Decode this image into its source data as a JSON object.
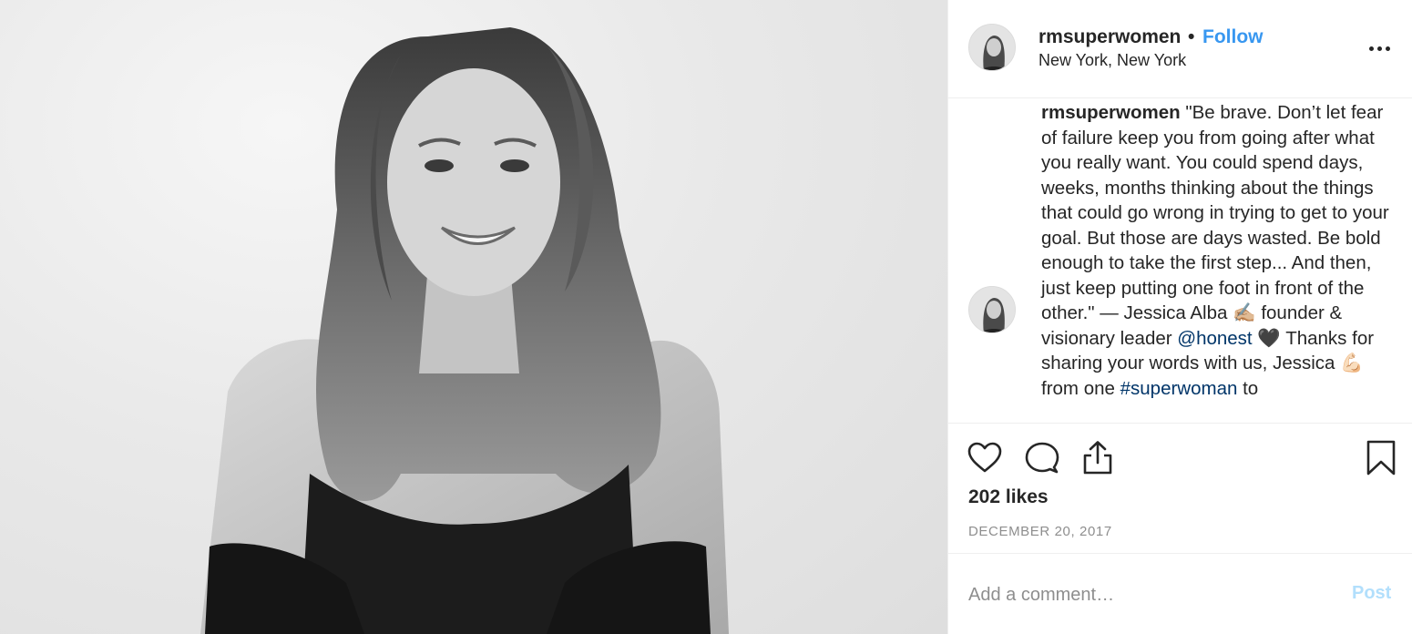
{
  "post": {
    "image_alt": "Black and white portrait photo",
    "header": {
      "username": "rmsuperwomen",
      "separator": "•",
      "follow_label": "Follow",
      "location": "New York, New York",
      "more_icon": "more-horizontal-icon"
    },
    "caption": {
      "username": "rmsuperwomen",
      "text_1": " \"Be brave. Don’t let fear of failure keep you from going after what you really want. You could spend days, weeks, months thinking about the things that could go wrong in trying to get to your goal. But those are days wasted. Be bold enough to take the first step... And then, just keep putting one foot in front of the other.\" — Jessica Alba ",
      "emoji_1": "✍🏼",
      "text_2": "  founder & visionary leader ",
      "mention": "@honest",
      "text_3": " ",
      "emoji_2": "🖤",
      "text_4": "  Thanks for sharing your words with us, Jessica ",
      "emoji_3": "💪🏻",
      "text_5": "  from one ",
      "hashtag": "#superwoman",
      "text_6": " to"
    },
    "actions": {
      "like_icon": "heart-icon",
      "comment_icon": "comment-icon",
      "share_icon": "share-icon",
      "save_icon": "bookmark-icon"
    },
    "likes": "202 likes",
    "date": "DECEMBER 20, 2017",
    "comment": {
      "placeholder": "Add a comment…",
      "post_label": "Post"
    },
    "colors": {
      "link_blue": "#3897f0",
      "tag_blue": "#003569",
      "post_disabled": "#b2dffc",
      "muted": "#8e8e8e",
      "text": "#262626"
    }
  }
}
